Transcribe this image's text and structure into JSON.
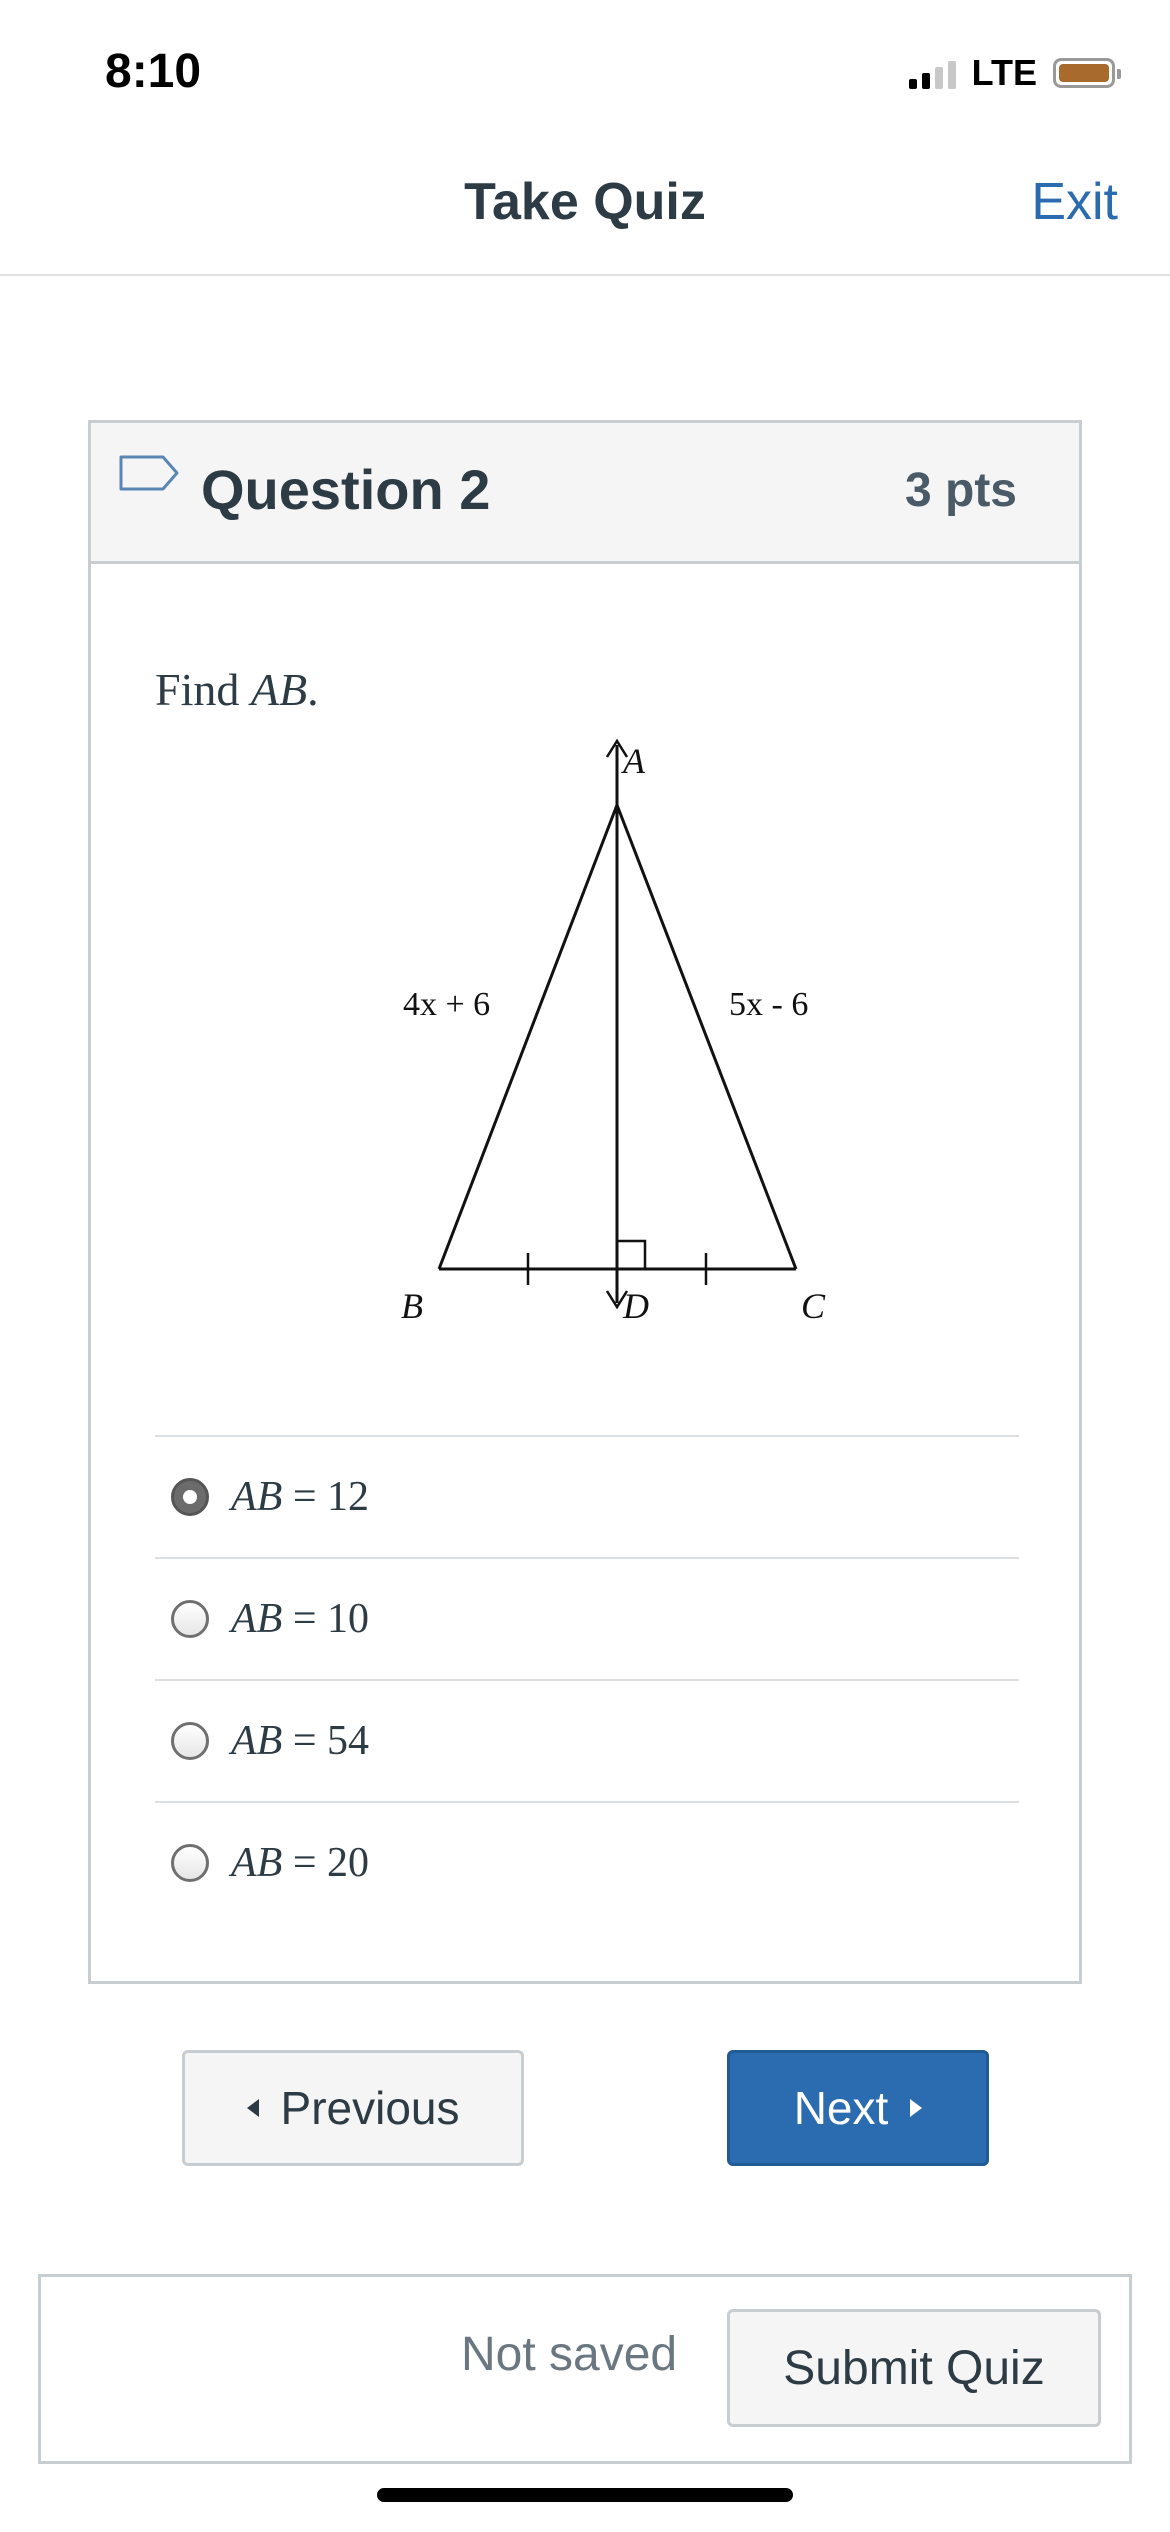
{
  "status_bar": {
    "time": "8:10",
    "network": "LTE",
    "battery_color": "#a86a2d"
  },
  "header": {
    "title": "Take Quiz",
    "exit_label": "Exit"
  },
  "question": {
    "title": "Question 2",
    "points": "3 pts",
    "prompt_prefix": "Find ",
    "prompt_var": "AB",
    "prompt_suffix": ".",
    "diagram": {
      "vertex_a": "A",
      "vertex_b": "B",
      "vertex_c": "C",
      "vertex_d": "D",
      "label_ab": "4x + 6",
      "label_ac": "5x - 6"
    },
    "answers": [
      {
        "var": "AB",
        "rest": " = 12",
        "selected": true
      },
      {
        "var": "AB",
        "rest": " = 10",
        "selected": false
      },
      {
        "var": "AB",
        "rest": " = 54",
        "selected": false
      },
      {
        "var": "AB",
        "rest": " = 20",
        "selected": false
      }
    ]
  },
  "navigation": {
    "previous_label": "Previous",
    "next_label": "Next"
  },
  "footer": {
    "save_status": "Not saved",
    "submit_label": "Submit Quiz"
  },
  "colors": {
    "accent": "#2b6cb0",
    "text": "#2d3b45"
  }
}
